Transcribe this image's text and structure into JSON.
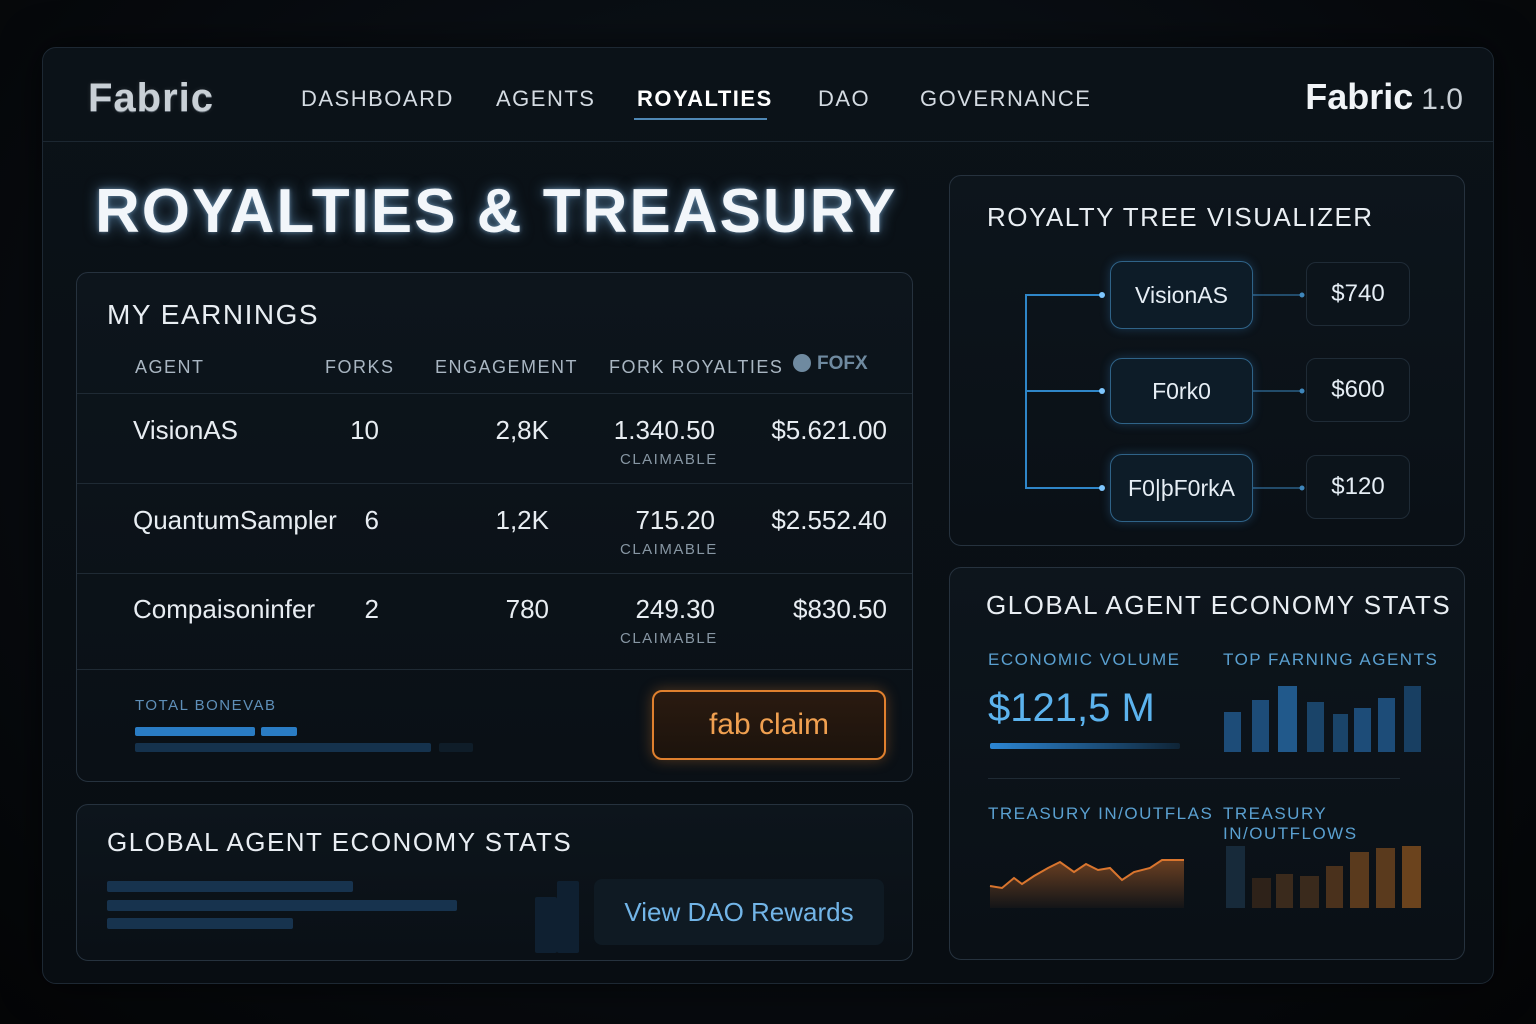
{
  "nav": {
    "logo": "Fabric",
    "items": [
      "DASHBOARD",
      "AGENTS",
      "ROYALTIES",
      "DAO",
      "GOVERNANCE"
    ],
    "active": "ROYALTIES",
    "brand": "Fabric",
    "version": "1.0"
  },
  "page": {
    "title": "ROYALTIES & TREASURY"
  },
  "earnings": {
    "title": "MY EARNINGS",
    "columns": [
      "AGENT",
      "FORKS",
      "ENGAGEMENT",
      "FORK ROYALTIES",
      "FOFX"
    ],
    "rows": [
      {
        "agent": "VisionAS",
        "forks": "10",
        "engagement": "2,8K",
        "royalties": "1.340.50",
        "status": "CLAIMABLE",
        "total": "$5.621.00"
      },
      {
        "agent": "QuantumSampler",
        "forks": "6",
        "engagement": "1,2K",
        "royalties": "715.20",
        "status": "CLAIMABLE",
        "total": "$2.552.40"
      },
      {
        "agent": "Compaisoninfer",
        "forks": "2",
        "engagement": "780",
        "royalties": "249.30",
        "status": "CLAIMABLE",
        "total": "$830.50"
      }
    ],
    "total_label": "TOTAL BONEVAB",
    "claim_button": "fab claim"
  },
  "global_stats_left": {
    "title": "GLOBAL AGENT ECONOMY STATS",
    "button": "View DAO Rewards"
  },
  "tree": {
    "title": "ROYALTY TREE VISUALIZER",
    "nodes": [
      {
        "name": "VisionAS",
        "amount": "$740"
      },
      {
        "name": "F0rk0",
        "amount": "$600"
      },
      {
        "name": "F0|þF0rkA",
        "amount": "$120"
      }
    ]
  },
  "economy": {
    "title": "GLOBAL AGENT ECONOMY STATS",
    "volume_label": "ECONOMIC VOLUME",
    "volume_value": "$121,5 M",
    "top_label": "TOP FARNING AGENTS",
    "treasury_label_1": "TREASURY IN/OUTFLAS",
    "treasury_label_2": "TREASURY IN/OUTFLOWS"
  },
  "colors": {
    "accent_blue": "#5cb3ee",
    "accent_orange": "#e0802e",
    "panel_border": "#26323e"
  }
}
